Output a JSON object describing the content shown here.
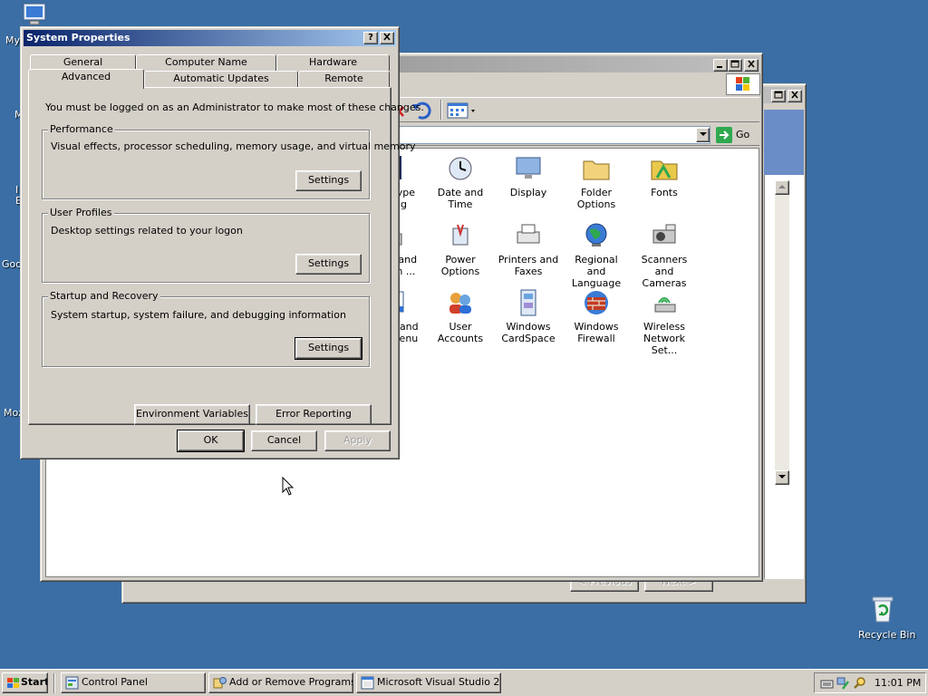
{
  "desktop": {
    "icons": [
      {
        "name": "my-computer",
        "label": "My"
      },
      {
        "name": "my-network",
        "label": "M"
      },
      {
        "name": "ie",
        "label": "I"
      },
      {
        "name": "ie2",
        "label": "E"
      },
      {
        "name": "google",
        "label": "Goo"
      },
      {
        "name": "mozilla",
        "label": "Moz"
      }
    ],
    "recycle_bin": "Recycle Bin"
  },
  "back_window": {
    "previous_label": "< Previous",
    "next_label": "Next >"
  },
  "control_panel": {
    "go_label": "Go",
    "items": [
      [
        "ClearType Tuning",
        "Date and Time",
        "Display",
        "Folder Options",
        "Fonts"
      ],
      [
        "Phone and Modem ...",
        "Power Options",
        "Printers and Faxes",
        "Regional and Language ...",
        "Scanners and Cameras"
      ],
      [
        "askbar and Start Menu",
        "User Accounts",
        "Windows CardSpace",
        "Windows Firewall",
        "Wireless Network Set..."
      ]
    ]
  },
  "dialog": {
    "title": "System Properties",
    "tabs_row1": [
      "General",
      "Computer Name",
      "Hardware"
    ],
    "tabs_row2": [
      "Advanced",
      "Automatic Updates",
      "Remote"
    ],
    "notice": "You must be logged on as an Administrator to make most of these changes.",
    "performance": {
      "title": "Performance",
      "desc": "Visual effects, processor scheduling, memory usage, and virtual memory",
      "button": "Settings"
    },
    "user_profiles": {
      "title": "User Profiles",
      "desc": "Desktop settings related to your logon",
      "button": "Settings"
    },
    "startup": {
      "title": "Startup and Recovery",
      "desc": "System startup, system failure, and debugging information",
      "button": "Settings"
    },
    "env_button": "Environment Variables",
    "error_button": "Error Reporting",
    "ok": "OK",
    "cancel": "Cancel",
    "apply": "Apply"
  },
  "taskbar": {
    "start": "Start",
    "tasks": [
      "Control Panel",
      "Add or Remove Programs",
      "Microsoft Visual Studio 2..."
    ],
    "clock": "11:01 PM"
  },
  "colors": {
    "desktop": "#3a6ea5",
    "title_active": "#0a246a",
    "face": "#d4d0c8"
  }
}
